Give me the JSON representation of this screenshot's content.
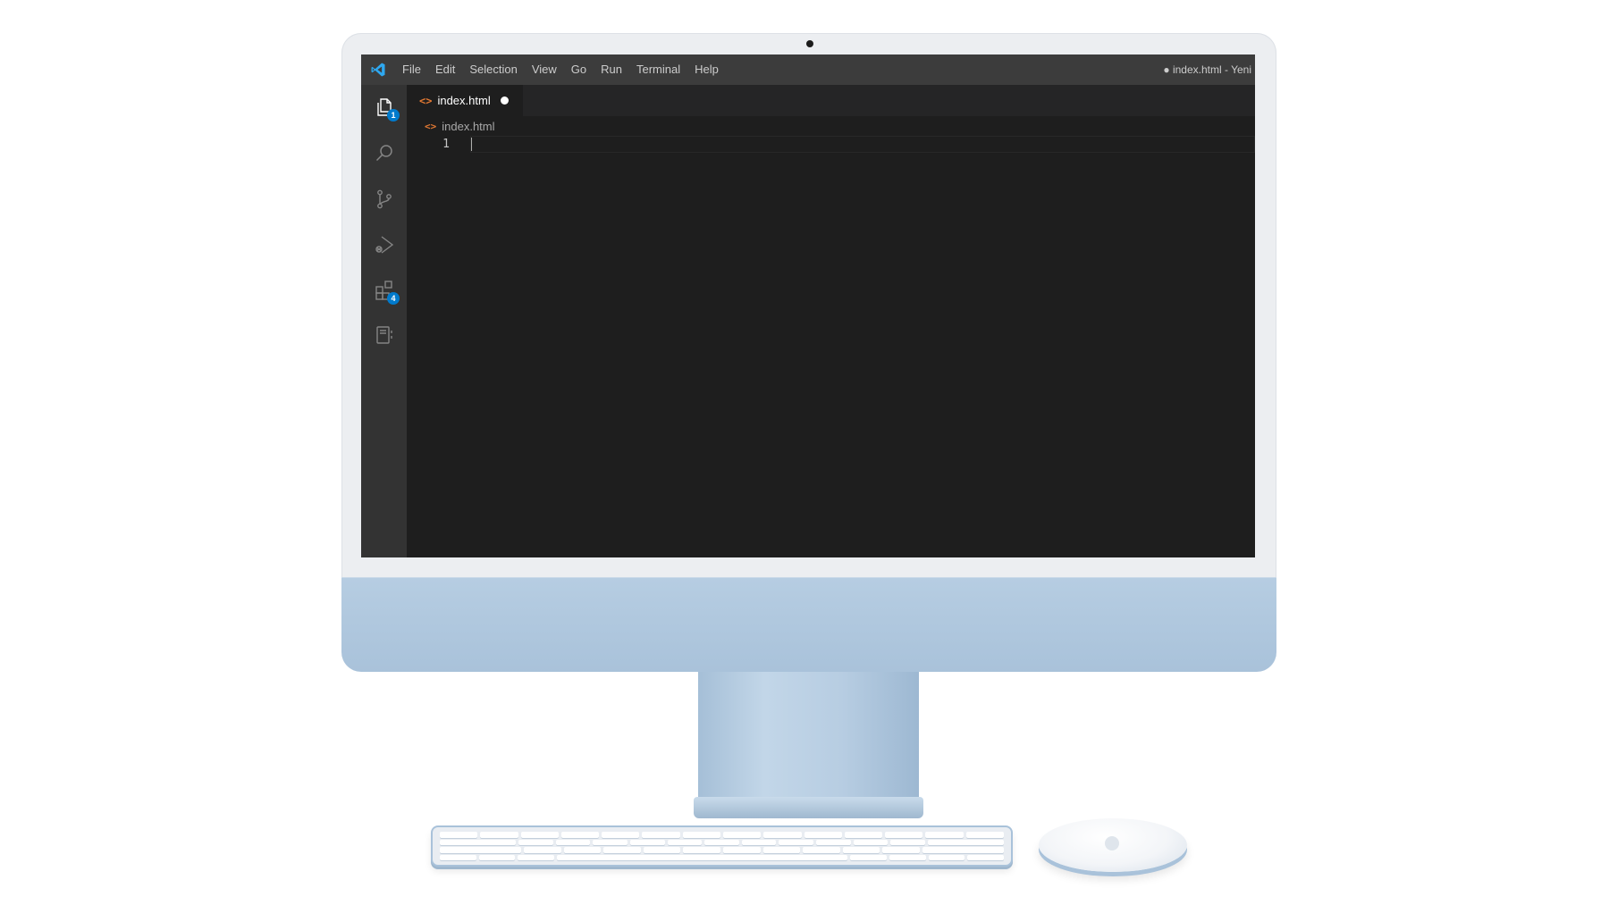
{
  "app": {
    "logo_icon": "vscode-logo-icon",
    "accent_color": "#007acc"
  },
  "menu": {
    "items": [
      "File",
      "Edit",
      "Selection",
      "View",
      "Go",
      "Run",
      "Terminal",
      "Help"
    ]
  },
  "window": {
    "title": "● index.html - Yeni"
  },
  "activity_bar": {
    "items": [
      {
        "icon": "explorer-icon",
        "badge": "1"
      },
      {
        "icon": "search-icon",
        "badge": ""
      },
      {
        "icon": "source-control-icon",
        "badge": ""
      },
      {
        "icon": "run-debug-icon",
        "badge": ""
      },
      {
        "icon": "extensions-icon",
        "badge": "4"
      },
      {
        "icon": "remote-explorer-icon",
        "badge": ""
      }
    ]
  },
  "tabs": [
    {
      "label": "index.html",
      "icon": "html-file-icon",
      "icon_glyph": "<>",
      "dirty": true,
      "active": true
    }
  ],
  "breadcrumb": {
    "icon": "html-file-icon",
    "icon_glyph": "<>",
    "label": "index.html"
  },
  "editor": {
    "line_numbers": [
      "1"
    ],
    "content": ""
  }
}
